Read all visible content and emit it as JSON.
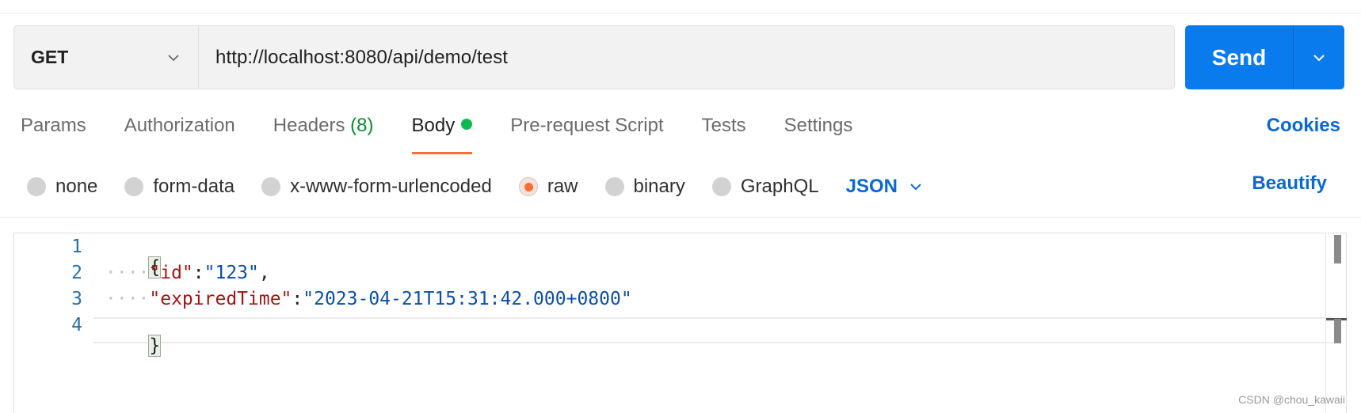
{
  "request": {
    "method": "GET",
    "url": "http://localhost:8080/api/demo/test",
    "send_label": "Send"
  },
  "tabs": [
    {
      "label": "Params"
    },
    {
      "label": "Authorization"
    },
    {
      "label": "Headers",
      "count": "(8)"
    },
    {
      "label": "Body",
      "active": true
    },
    {
      "label": "Pre-request Script"
    },
    {
      "label": "Tests"
    },
    {
      "label": "Settings"
    }
  ],
  "cookies_label": "Cookies",
  "body_types": [
    {
      "label": "none"
    },
    {
      "label": "form-data"
    },
    {
      "label": "x-www-form-urlencoded"
    },
    {
      "label": "raw",
      "selected": true
    },
    {
      "label": "binary"
    },
    {
      "label": "GraphQL"
    }
  ],
  "format": "JSON",
  "beautify_label": "Beautify",
  "editor": {
    "line_numbers": [
      "1",
      "2",
      "3",
      "4"
    ],
    "open_brace": "{",
    "close_brace": "}",
    "indent": "····",
    "line2": {
      "key": "\"id\"",
      "colon": ":",
      "value": "\"123\"",
      "comma": ","
    },
    "line3": {
      "key": "\"expiredTime\"",
      "colon": ":",
      "value": "\"2023-04-21T15:31:42.000+0800\""
    }
  },
  "watermark": "CSDN @chou_kawaii",
  "colors": {
    "accent": "#097bed",
    "active_tab": "#ff6c37",
    "link": "#0b68d0",
    "body_dot": "#0cbb52"
  }
}
